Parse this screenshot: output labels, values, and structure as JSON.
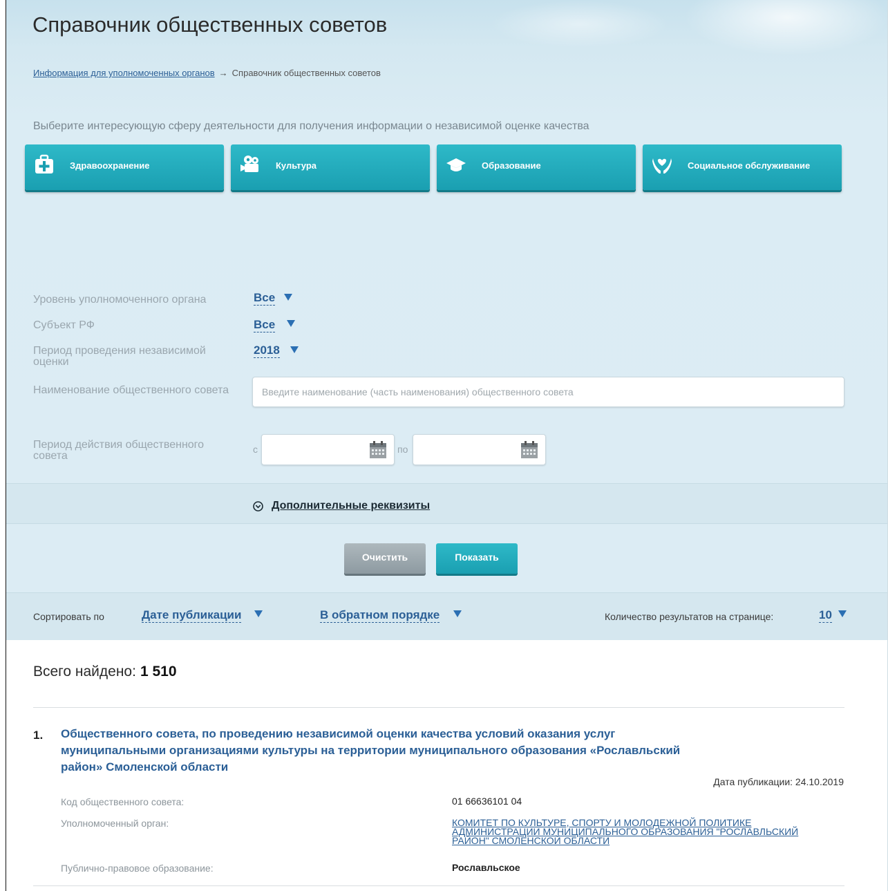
{
  "page": {
    "title": "Справочник общественных советов"
  },
  "breadcrumb": {
    "link": "Информация для уполномоченных органов",
    "separator": "→",
    "current": "Справочник общественных советов"
  },
  "intro": "Выберите интересующую сферу деятельности для получения информации о независимой оценке качества",
  "spheres": [
    {
      "label": "Здравоохранение",
      "icon": "first-aid-kit-icon"
    },
    {
      "label": "Культура",
      "icon": "film-camera-icon"
    },
    {
      "label": "Образование",
      "icon": "graduation-cap-icon"
    },
    {
      "label": "Социальное обслуживание",
      "icon": "caring-hands-icon"
    }
  ],
  "filters": {
    "level": {
      "label": "Уровень уполномоченного органа",
      "value": "Все"
    },
    "subject": {
      "label": "Субъект РФ",
      "value": "Все"
    },
    "period": {
      "label": "Период проведения независимой оценки",
      "value": "2018"
    },
    "name": {
      "label": "Наименование общественного совета",
      "placeholder": "Введите наименование (часть наименования) общественного совета",
      "value": ""
    },
    "validity": {
      "label": "Период действия общественного совета",
      "from_label": "с",
      "to_label": "по",
      "from": "",
      "to": ""
    }
  },
  "extra_fields": "Дополнительные реквизиты",
  "buttons": {
    "clear": "Очистить",
    "show": "Показать"
  },
  "sorting": {
    "label": "Сортировать по",
    "field": "Дате публикации",
    "order": "В обратном порядке",
    "per_page_label": "Количество результатов на странице:",
    "per_page": "10"
  },
  "results": {
    "total_label": "Всего найдено:",
    "total": "1 510",
    "items": [
      {
        "number": "1.",
        "title": "Общественного совета, по проведению независимой оценки качества условий оказания услуг муниципальными организациями культуры на территории муниципального образования «Рославльский район» Смоленской области",
        "publication_date": "Дата публикации: 24.10.2019",
        "code_label": "Код общественного совета:",
        "code": "01 66636101 04",
        "authority_label": "Уполномоченный орган:",
        "authority": "КОМИТЕТ ПО КУЛЬТУРЕ, СПОРТУ И МОЛОДЕЖНОЙ ПОЛИТИКЕ АДМИНИСТРАЦИИ МУНИЦИПАЛЬНОГО ОБРАЗОВАНИЯ \"РОСЛАВЛЬСКИЙ РАЙОН\" СМОЛЕНСКОЙ ОБЛАСТИ",
        "entity_label": "Публично-правовое образование:",
        "entity": "Рославльское"
      }
    ]
  },
  "colors": {
    "accent": "#1fa9ba",
    "link": "#2b5f96",
    "background": "#dcecf4"
  }
}
